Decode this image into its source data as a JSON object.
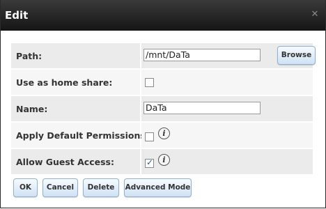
{
  "dialog": {
    "title": "Edit",
    "close_icon": "close-icon"
  },
  "fields": {
    "path": {
      "label": "Path:",
      "value": "/mnt/DaTa",
      "browse_label": "Browse"
    },
    "home_share": {
      "label": "Use as home share:",
      "checked": false
    },
    "name": {
      "label": "Name:",
      "value": "DaTa"
    },
    "default_permissions": {
      "label": "Apply Default Permissions:",
      "checked": false,
      "info_icon": "info-icon"
    },
    "guest_access": {
      "label": "Allow Guest Access:",
      "checked": true,
      "info_icon": "info-icon"
    }
  },
  "buttons": {
    "ok": "OK",
    "cancel": "Cancel",
    "delete": "Delete",
    "advanced": "Advanced Mode"
  },
  "colors": {
    "titlebar": "#1f1f1f",
    "button_border": "#8fb0d0",
    "row_bg": "#ebebeb"
  }
}
